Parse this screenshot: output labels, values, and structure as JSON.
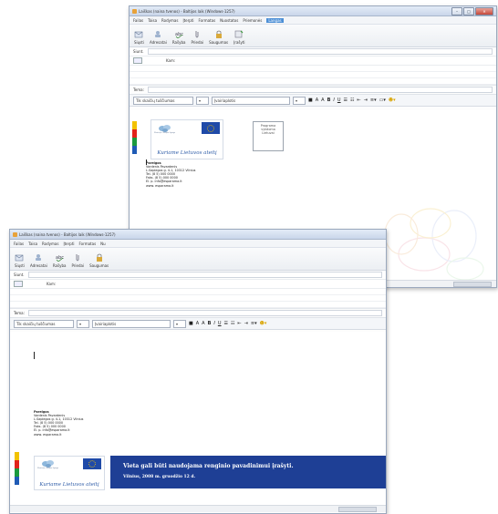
{
  "back_window": {
    "title": "Laiškas (naina tvenos) - Baltijos laik (Windows-1257)",
    "menu": [
      "Failas",
      "Taisa",
      "Rodymas",
      "Įterpti",
      "Formatas",
      "Nuostatos",
      "Priemonės",
      "Langas"
    ],
    "active_menu_index": 7,
    "toolbar": [
      "Siųsti",
      "Adresatai",
      "Rašyba",
      "Priedai",
      "Saugumas",
      "Įrašyti"
    ],
    "sender_label": "Siunt.",
    "to_label": "Kam:",
    "subject_label": "Tema:",
    "paragraph_style": "Tik skaičių tuščiumas",
    "font": "Įvairiaplotis",
    "promo_text": [
      "Programa",
      "vykdoma",
      "Lietuvai"
    ],
    "signature": {
      "company": "Pareigos",
      "name": "Vardenis Pavardenis",
      "address": "L.Sapiegos g. 4-1, 10312 Vilnius",
      "tel": "Tel. (8 5) 000 0000",
      "fax": "Faks. (8 5) 000 0000",
      "email": "El. p. info@esparama.lt",
      "web": "www. esparama.lt"
    },
    "logo_caption": "Kuriame Lietuvos ateitį",
    "logo_small": "Ministerija / Europos Sąjunga"
  },
  "front_window": {
    "title": "Laiškas (naina tvenos) - Baltijos laik (Windows-1257)",
    "menu": [
      "Failas",
      "Taisa",
      "Rodymas",
      "Įterpti",
      "Formatas",
      "Nu"
    ],
    "toolbar": [
      "Siųsti",
      "Adresatai",
      "Rašyba",
      "Priedai",
      "Saugumas"
    ],
    "sender_label": "Siunt.",
    "to_label": "Kam:",
    "subject_label": "Tema:",
    "paragraph_style": "Tik skaičių tuščiumas",
    "font": "Įvairiaplotis",
    "signature": {
      "company": "Pareigos",
      "name": "Vardenis Pavardenis",
      "address": "L.Sapiegos g. 4-1, 10312 Vilnius",
      "tel": "Tel. (8 5) 000 0000",
      "fax": "Faks. (8 5) 000 0000",
      "email": "El. p. info@esparama.lt",
      "web": "www. esparama.lt"
    },
    "logo_caption": "Kuriame Lietuvos ateitį",
    "logo_small": "Ministerija / Europos Sąjunga",
    "banner_line1": "Vieta gali būti naudojama renginio pavadinimui įrašyti.",
    "banner_line2": "Vilnius, 2008 m. gruodžio 12 d."
  },
  "colors": {
    "strip": [
      "#f2c200",
      "#e2231a",
      "#1b9a3e",
      "#1f5bb5"
    ],
    "banner": "#1e3f95",
    "accent": "#4c8fd6"
  }
}
